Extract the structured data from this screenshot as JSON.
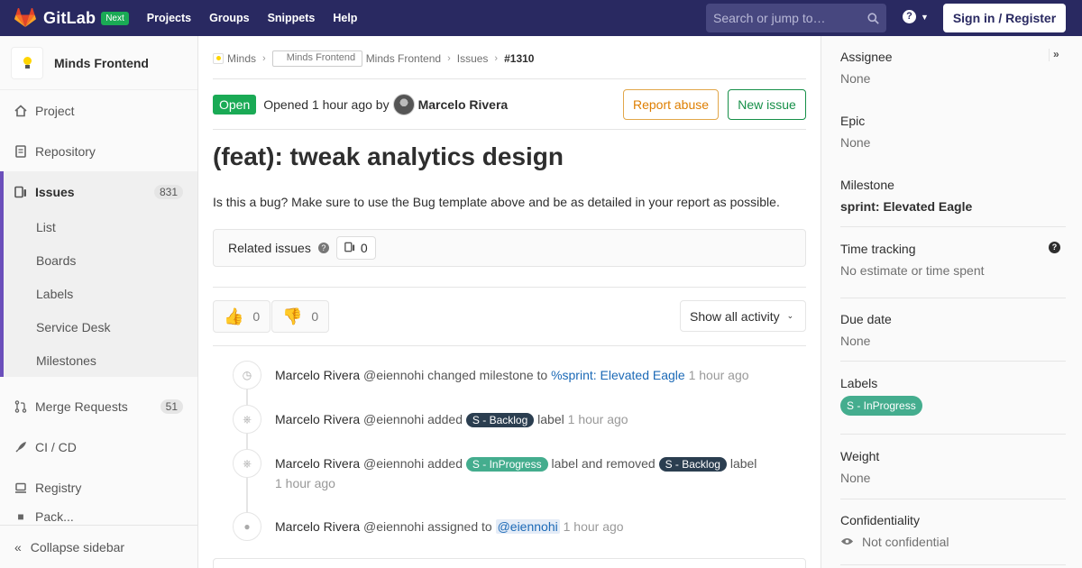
{
  "navbar": {
    "brand": "GitLab",
    "next_badge": "Next",
    "links": [
      "Projects",
      "Groups",
      "Snippets",
      "Help"
    ],
    "search_placeholder": "Search or jump to…",
    "signin_label": "Sign in / Register"
  },
  "sidebar": {
    "project_name": "Minds Frontend",
    "items": [
      {
        "label": "Project"
      },
      {
        "label": "Repository"
      },
      {
        "label": "Issues",
        "count": "831"
      },
      {
        "label": "Merge Requests",
        "count": "51"
      },
      {
        "label": "CI / CD"
      },
      {
        "label": "Registry"
      },
      {
        "label": "Pack..."
      }
    ],
    "sub_items": [
      "List",
      "Boards",
      "Labels",
      "Service Desk",
      "Milestones"
    ],
    "collapse_label": "Collapse sidebar"
  },
  "breadcrumb": {
    "group": "Minds",
    "project_img_alt": "Minds Frontend",
    "project": "Minds Frontend",
    "issues": "Issues",
    "current": "#1310"
  },
  "issue": {
    "status": "Open",
    "opened_text": "Opened 1 hour ago by",
    "author": "Marcelo Rivera",
    "report_label": "Report abuse",
    "new_issue_label": "New issue",
    "title": "(feat): tweak analytics design",
    "description": "Is this a bug? Make sure to use the Bug template above and be as detailed in your report as possible.",
    "related_label": "Related issues",
    "related_count": "0",
    "thumbs_up": "0",
    "thumbs_down": "0",
    "activity_filter": "Show all activity"
  },
  "timeline": {
    "n1": {
      "who": "Marcelo Rivera",
      "handle": "@eiennohi",
      "action": "changed milestone to",
      "link": "%sprint: Elevated Eagle",
      "time": "1 hour ago"
    },
    "n2": {
      "who": "Marcelo Rivera",
      "handle": "@eiennohi",
      "action": "added",
      "label": "S - Backlog",
      "suffix": "label",
      "time": "1 hour ago"
    },
    "n3": {
      "who": "Marcelo Rivera",
      "handle": "@eiennohi",
      "action": "added",
      "label_added": "S - InProgress",
      "middle": "label and removed",
      "label_removed": "S - Backlog",
      "suffix": "label",
      "time": "1 hour ago"
    },
    "n4": {
      "who": "Marcelo Rivera",
      "handle": "@eiennohi",
      "action": "assigned to",
      "mention": "@eiennohi",
      "time": "1 hour ago"
    }
  },
  "right_sidebar": {
    "assignee": {
      "title": "Assignee",
      "value": "None"
    },
    "epic": {
      "title": "Epic",
      "value": "None"
    },
    "milestone": {
      "title": "Milestone",
      "value": "sprint: Elevated Eagle"
    },
    "time_tracking": {
      "title": "Time tracking",
      "value": "No estimate or time spent"
    },
    "due_date": {
      "title": "Due date",
      "value": "None"
    },
    "labels": {
      "title": "Labels",
      "value": "S - InProgress"
    },
    "weight": {
      "title": "Weight",
      "value": "None"
    },
    "confidentiality": {
      "title": "Confidentiality",
      "value": "Not confidential"
    }
  },
  "colors": {
    "navbar": "#292961",
    "open_green": "#1aaa55",
    "label_dark": "#2b3e50",
    "label_green": "#44ad8e",
    "link": "#1b69b6",
    "report_orange": "#de7e00"
  }
}
